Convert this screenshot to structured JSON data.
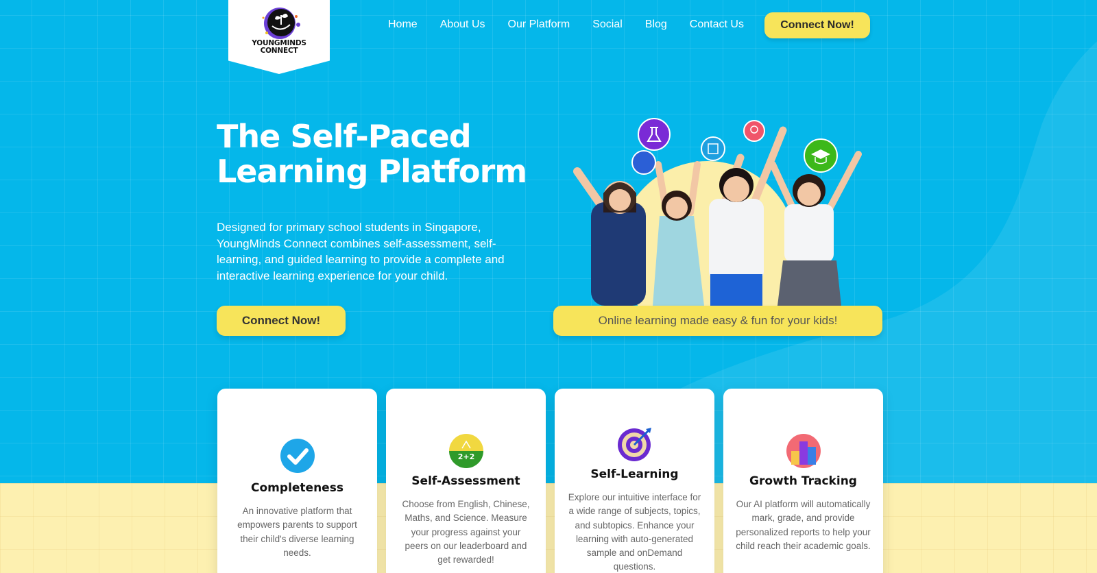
{
  "logo": {
    "line1": "YOUNGMINDS",
    "line2": "CONNECT"
  },
  "nav": {
    "items": [
      "Home",
      "About Us",
      "Our Platform",
      "Social",
      "Blog",
      "Contact Us"
    ],
    "cta": "Connect Now!"
  },
  "hero": {
    "title_line1": "The Self-Paced",
    "title_line2": "Learning Platform",
    "description": "Designed for primary school students in Singapore, YoungMinds Connect combines self-assessment, self-learning, and guided learning to provide a complete and interactive learning experience for your child.",
    "cta": "Connect Now!",
    "tagline": "Online learning made easy & fun for your kids!"
  },
  "cards": [
    {
      "title": "Completeness",
      "icon": "check-circle-icon",
      "text": "An innovative platform that empowers parents to support their child's diverse learning needs."
    },
    {
      "title": "Self-Assessment",
      "icon": "math-2plus2-icon",
      "text": "Choose from English, Chinese, Maths, and Science. Measure your progress against your peers on our leaderboard and get rewarded!"
    },
    {
      "title": "Self-Learning",
      "icon": "target-icon",
      "text": "Explore our intuitive interface for a wide range of subjects, topics, and subtopics. Enhance your learning with auto-generated sample and onDemand questions."
    },
    {
      "title": "Growth Tracking",
      "icon": "bar-chart-icon",
      "text": "Our AI platform will automatically mark, grade, and provide personalized reports to help your child reach their academic goals."
    }
  ],
  "colors": {
    "hero_bg": "#05b7ea",
    "accent_yellow": "#f7e45a",
    "bottom_bg": "#fdf0b0"
  }
}
